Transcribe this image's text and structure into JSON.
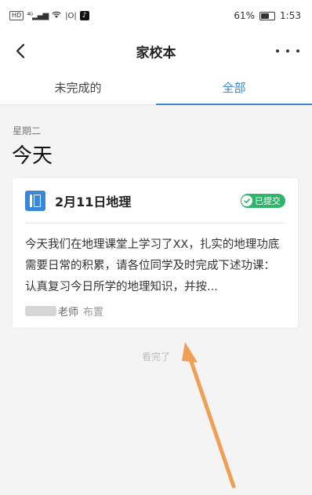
{
  "status_bar": {
    "left_icons": [
      "HD",
      "4G",
      "signal-icon",
      "wifi-icon",
      "nfc-icon",
      "tiktok-icon"
    ],
    "battery_percent_label": "61%",
    "battery_level": 0.61,
    "time": "1:53"
  },
  "navbar": {
    "title": "家校本",
    "back_icon": "chevron-left-icon",
    "more_icon": "more-dots-icon"
  },
  "tabs": [
    {
      "label": "未完成的",
      "active": false
    },
    {
      "label": "全部",
      "active": true
    }
  ],
  "section": {
    "weekday": "星期二",
    "day_label": "今天"
  },
  "card": {
    "icon": "book-icon",
    "title": "2月11日地理",
    "status_badge": "已提交",
    "body": "今天我们在地理课堂上学习了XX，扎实的地理功底需要日常的积累，请各位同学及时完成下述功课：认真复习今日所学的地理知识，并按...",
    "teacher_suffix": "老师",
    "action": "布置"
  },
  "end_text": "看完了",
  "colors": {
    "accent": "#3a86d8",
    "success": "#2fb56b",
    "annotation_arrow": "#f0a055"
  }
}
